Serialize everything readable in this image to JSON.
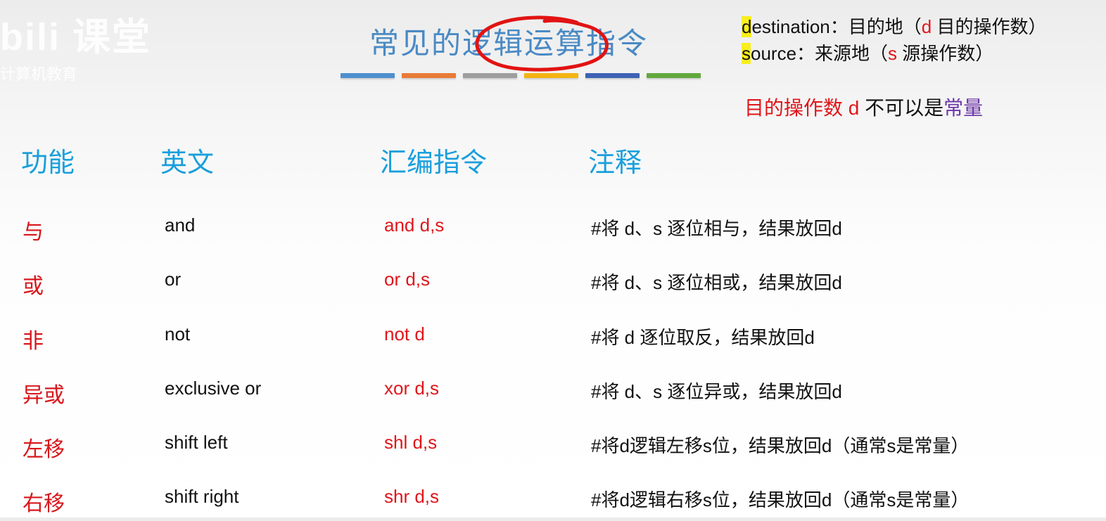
{
  "watermark": {
    "logo": "bili 课堂",
    "sub": "计算机教育"
  },
  "title": "常见的逻辑运算指令",
  "bar_colors": [
    "#4e8fcf",
    "#e87b37",
    "#9e9e9e",
    "#f4b411",
    "#3e62b5",
    "#62a83e"
  ],
  "notes": {
    "dest_highlight": "d",
    "dest_rest": "estination：目的地（",
    "dest_letter": "d",
    "dest_tail": " 目的操作数）",
    "src_highlight": "s",
    "src_rest": "ource：来源地（",
    "src_letter": "s",
    "src_tail": " 源操作数）",
    "rule_red": "目的操作数 d",
    "rule_black": " 不可以是",
    "rule_purple": "常量"
  },
  "table": {
    "headers": {
      "func": "功能",
      "en": "英文",
      "asm": "汇编指令",
      "note": "注释"
    },
    "rows": [
      {
        "func": "与",
        "en": "and",
        "asm": "and d,s",
        "note": "#将 d、s 逐位相与，结果放回d"
      },
      {
        "func": "或",
        "en": "or",
        "asm": "or d,s",
        "note": "#将 d、s 逐位相或，结果放回d"
      },
      {
        "func": "非",
        "en": "not",
        "asm": "not d",
        "note": "#将 d 逐位取反，结果放回d"
      },
      {
        "func": "异或",
        "en": "exclusive or",
        "asm": "xor d,s",
        "note": "#将 d、s 逐位异或，结果放回d"
      },
      {
        "func": "左移",
        "en": "shift left",
        "asm": "shl d,s",
        "note": "#将d逻辑左移s位，结果放回d（通常s是常量）"
      },
      {
        "func": "右移",
        "en": "shift right",
        "asm": "shr d,s",
        "note": "#将d逻辑右移s位，结果放回d（通常s是常量）"
      }
    ]
  }
}
